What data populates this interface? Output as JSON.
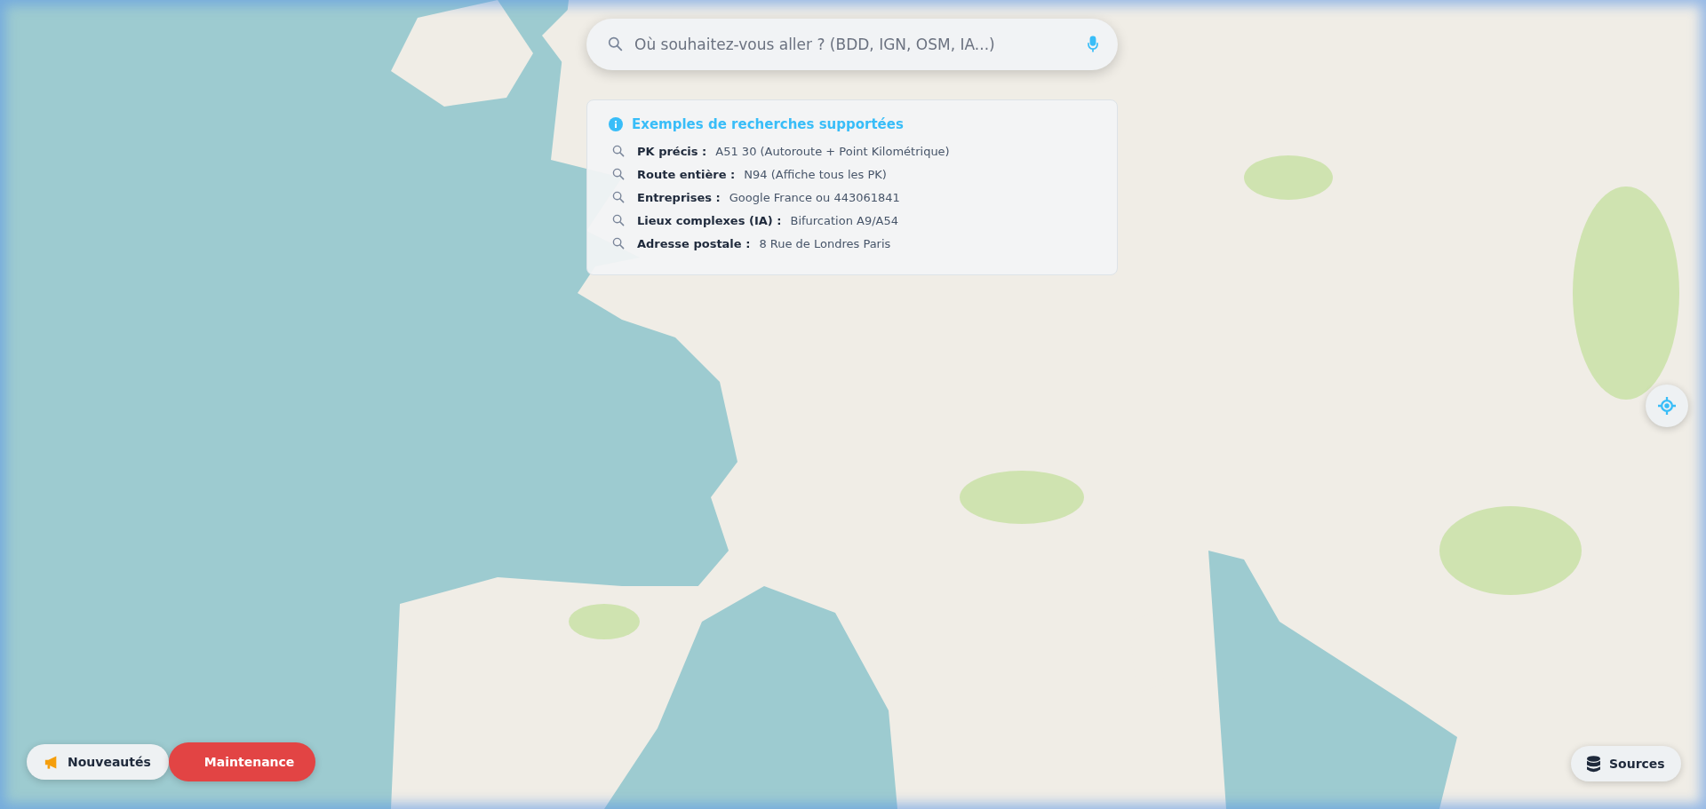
{
  "search": {
    "placeholder": "Où souhaitez-vous aller ? (BDD, IGN, OSM, IA...)"
  },
  "examples": {
    "title": "Exemples de recherches supportées",
    "items": [
      {
        "label": "PK précis :",
        "value": "A51 30 (Autoroute + Point Kilométrique)"
      },
      {
        "label": "Route entière :",
        "value": "N94 (Affiche tous les PK)"
      },
      {
        "label": "Entreprises :",
        "value": "Google France ou 443061841"
      },
      {
        "label": "Lieux complexes (IA) :",
        "value": "Bifurcation A9/A54"
      },
      {
        "label": "Adresse postale :",
        "value": "8 Rue de Londres Paris"
      }
    ]
  },
  "buttons": [
    {
      "label": "Nouveautés",
      "kind": "news"
    },
    {
      "label": "Maintenance",
      "kind": "alert"
    },
    {
      "label": "Sources",
      "kind": "sources"
    }
  ]
}
